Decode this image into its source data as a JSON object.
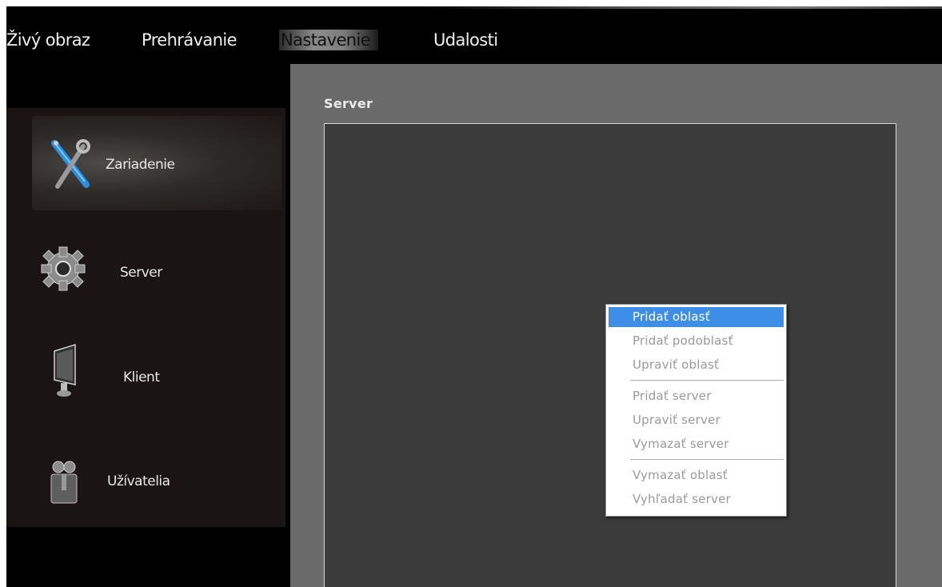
{
  "menu": {
    "items": [
      "Živý obraz",
      "Prehrávanie",
      "Nastavenie",
      "Udalosti"
    ],
    "active": "Nastavenie"
  },
  "sidebar": {
    "items": [
      {
        "label": "Zariadenie",
        "icon": "tools-icon",
        "active": true
      },
      {
        "label": "Server",
        "icon": "gear-icon",
        "active": false
      },
      {
        "label": "Klient",
        "icon": "monitor-icon",
        "active": false
      },
      {
        "label": "Užívatelia",
        "icon": "users-icon",
        "active": false
      }
    ]
  },
  "content": {
    "title": "Server"
  },
  "context_menu": {
    "items": [
      {
        "label": "Pridať oblasť",
        "highlighted": true
      },
      {
        "label": "Pridať podoblasť",
        "highlighted": false
      },
      {
        "label": "Upraviť oblasť",
        "highlighted": false
      },
      {
        "label": "Pridať server",
        "highlighted": false
      },
      {
        "label": "Upraviť server",
        "highlighted": false
      },
      {
        "label": "Vymazať server",
        "highlighted": false
      },
      {
        "label": "Vymazať oblasť",
        "highlighted": false
      },
      {
        "label": "Vyhľadať server",
        "highlighted": false
      }
    ]
  },
  "colors": {
    "highlight": "#3d8ee6",
    "content_bg": "#6a6a6a",
    "tree_bg": "#3b3b3b",
    "sidebar_bg": "#1a1514"
  }
}
